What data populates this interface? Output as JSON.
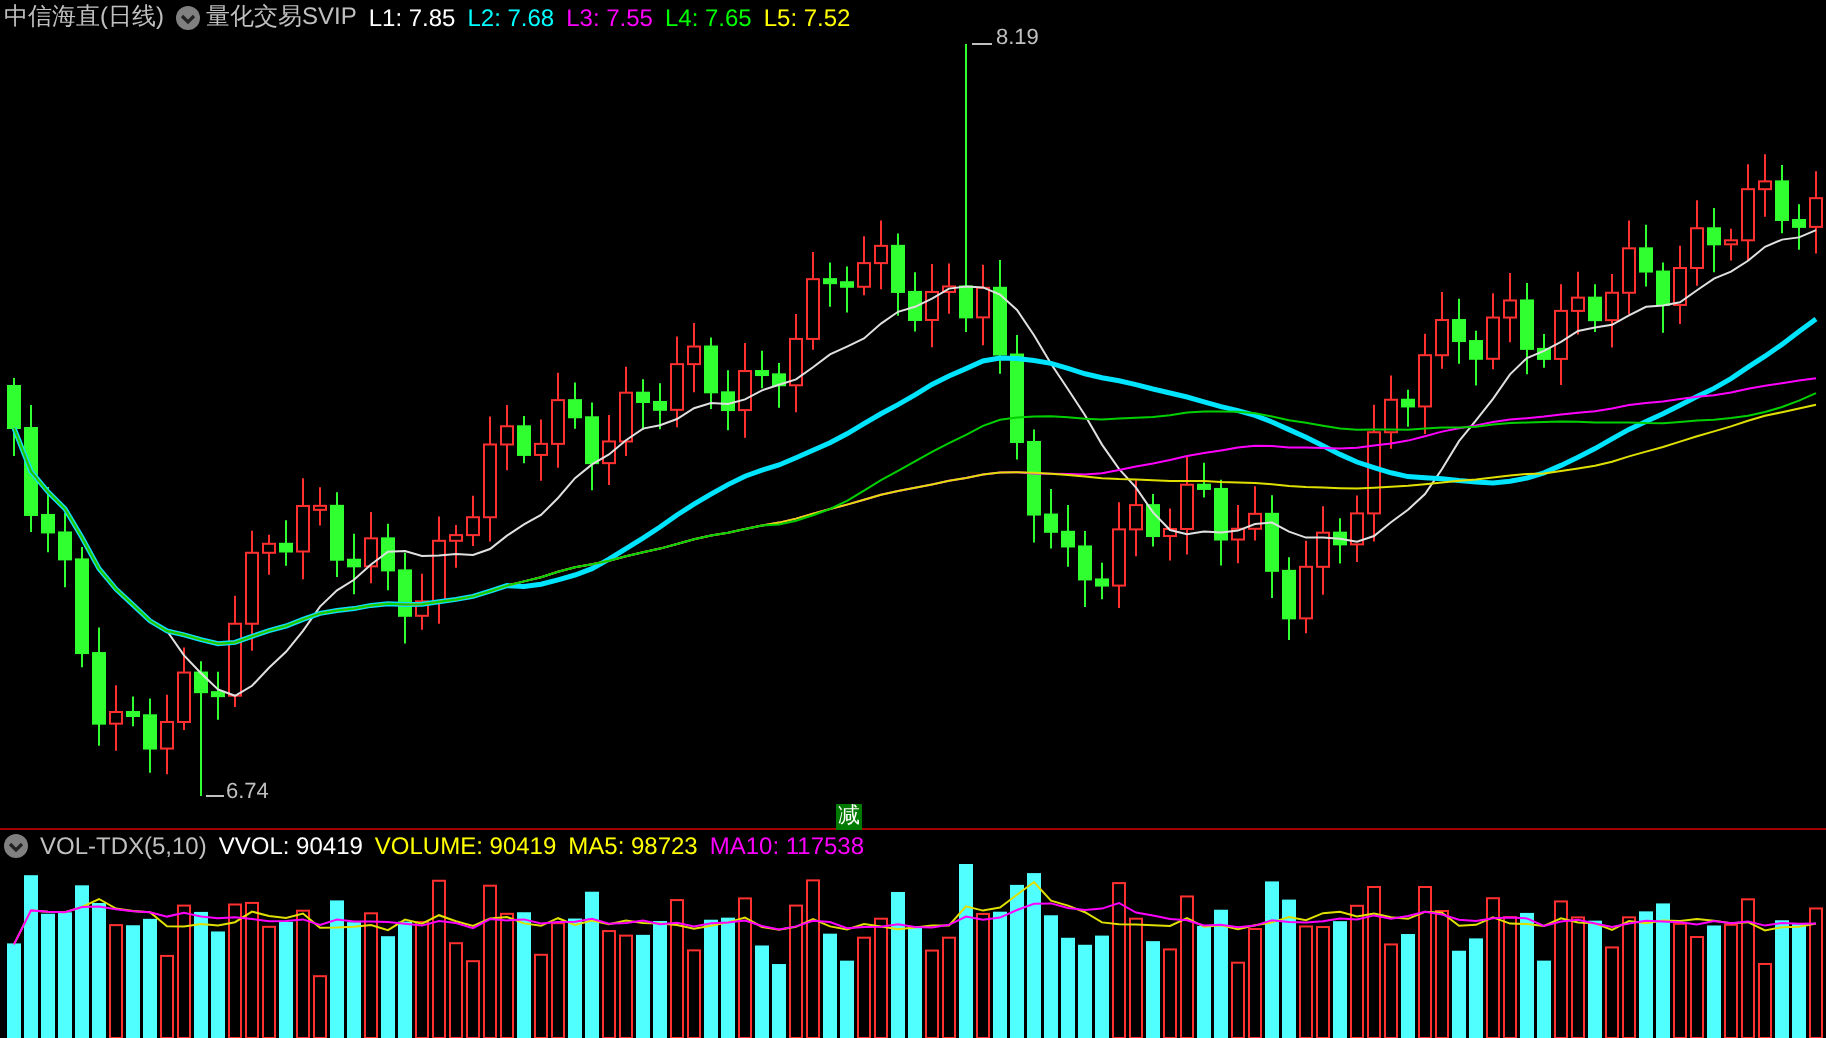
{
  "header": {
    "stock": "中信海直(日线)",
    "indicator": "量化交易SVIP"
  },
  "indicator_lines": [
    {
      "label": "L1: 7.85",
      "color": "#ffffff"
    },
    {
      "label": "L2: 7.68",
      "color": "#00ffff"
    },
    {
      "label": "L3: 7.55",
      "color": "#ff00ff"
    },
    {
      "label": "L4: 7.65",
      "color": "#00ff00"
    },
    {
      "label": "L5: 7.52",
      "color": "#ffff00"
    }
  ],
  "price_labels": [
    {
      "kind": "high",
      "text": "8.19"
    },
    {
      "kind": "low",
      "text": "6.74"
    }
  ],
  "signal_badge": "减",
  "volume_header": {
    "name": "VOL-TDX(5,10)",
    "values": [
      {
        "label": "VVOL: 90419",
        "color": "#ffffff"
      },
      {
        "label": "VOLUME: 90419",
        "color": "#ffff00"
      },
      {
        "label": "MA5: 98723",
        "color": "#ffff00"
      },
      {
        "label": "MA10: 117538",
        "color": "#ff00ff"
      }
    ]
  }
}
